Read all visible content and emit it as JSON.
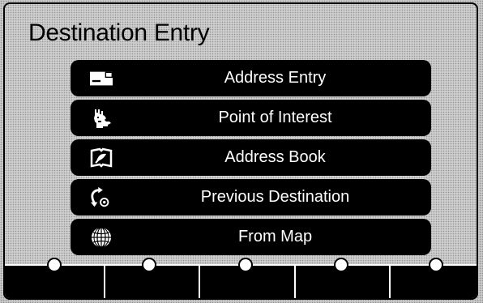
{
  "screen": {
    "title": "Destination Entry"
  },
  "menu": {
    "items": [
      {
        "label": "Address Entry",
        "icon": "envelope-icon"
      },
      {
        "label": "Point of Interest",
        "icon": "statue-of-liberty-icon"
      },
      {
        "label": "Address Book",
        "icon": "address-book-icon"
      },
      {
        "label": "Previous Destination",
        "icon": "return-arrow-icon"
      },
      {
        "label": "From Map",
        "icon": "globe-icon"
      }
    ]
  },
  "softkeys": {
    "count": 5,
    "labels": [
      "",
      "",
      "",
      "",
      ""
    ]
  },
  "colors": {
    "button_background": "#000000",
    "button_text": "#ffffff",
    "screen_background": "#c9c9c9"
  }
}
